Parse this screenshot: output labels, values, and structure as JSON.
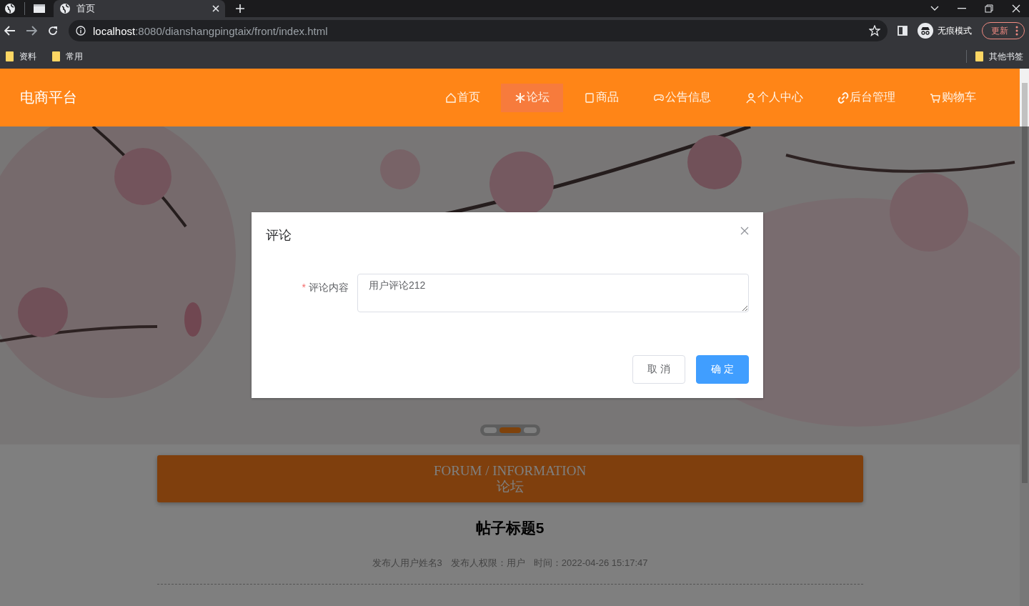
{
  "browser": {
    "tabs": [
      {
        "title": "首页",
        "selected": true
      }
    ],
    "address": {
      "host": "localhost",
      "path": ":8080/dianshangpingtaix/front/index.html"
    },
    "incognito_label": "无痕模式",
    "update_button": "更新",
    "bookmarks": [
      "资料",
      "常用"
    ],
    "other_bookmarks": "其他书签"
  },
  "site": {
    "logo": "电商平台",
    "nav": [
      {
        "label": "首页",
        "selected": false
      },
      {
        "label": "论坛",
        "selected": true
      },
      {
        "label": "商品",
        "selected": false
      },
      {
        "label": "公告信息",
        "selected": false
      },
      {
        "label": "个人中心",
        "selected": false
      },
      {
        "label": "后台管理",
        "selected": false
      },
      {
        "label": "购物车",
        "selected": false
      }
    ],
    "carousel_dots": [
      {
        "selected": false
      },
      {
        "selected": true
      },
      {
        "selected": false
      }
    ],
    "forum_header": {
      "title_en": "FORUM / INFORMATION",
      "title_cn": "论坛"
    },
    "post": {
      "title": "帖子标题5",
      "author": "发布人用户姓名3",
      "role": "发布人权限：用户",
      "time": "时间：2022-04-26 15:17:47"
    }
  },
  "dialog": {
    "title": "评论",
    "field": {
      "required_mark": "*",
      "label": "评论内容",
      "value": "用户评论212"
    },
    "buttons": [
      {
        "kind": "secondary",
        "label": "取 消"
      },
      {
        "kind": "primary",
        "label": "确 定"
      }
    ]
  }
}
